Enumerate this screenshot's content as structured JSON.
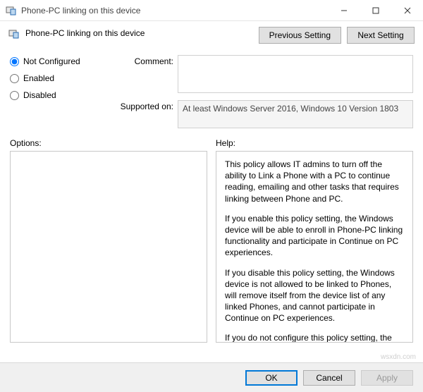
{
  "window": {
    "title": "Phone-PC linking on this device"
  },
  "header": {
    "title": "Phone-PC linking on this device",
    "previous_btn": "Previous Setting",
    "next_btn": "Next Setting"
  },
  "state": {
    "options": {
      "not_configured": "Not Configured",
      "enabled": "Enabled",
      "disabled": "Disabled"
    },
    "selected": "not_configured"
  },
  "fields": {
    "comment_label": "Comment:",
    "comment_value": "",
    "supported_label": "Supported on:",
    "supported_value": "At least Windows Server 2016, Windows 10 Version 1803"
  },
  "panes": {
    "options_label": "Options:",
    "help_label": "Help:",
    "options_content": "",
    "help_paragraphs": [
      "This policy allows IT admins to turn off the ability to Link a Phone with a PC to continue reading, emailing and other tasks that requires linking between Phone and PC.",
      "If you enable this policy setting, the Windows device will be able to enroll in Phone-PC linking functionality and participate in Continue on PC experiences.",
      "If you disable this policy setting, the Windows device is not allowed to be linked to Phones, will remove itself from the device list of any linked Phones, and cannot participate in Continue on PC experiences.",
      "If you do not configure this policy setting, the default behavior depends on the Windows edition. Changes to this policy take effect on reboot."
    ]
  },
  "buttons": {
    "ok": "OK",
    "cancel": "Cancel",
    "apply": "Apply"
  },
  "watermark": "wsxdn.com"
}
